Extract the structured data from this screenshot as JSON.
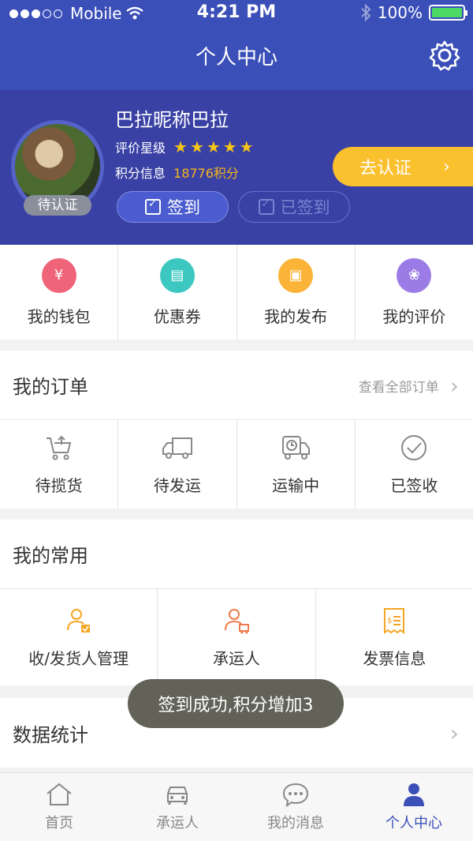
{
  "status_bar": {
    "carrier": "Mobile",
    "time": "4:21 PM",
    "battery": "100%"
  },
  "header": {
    "title": "个人中心"
  },
  "profile": {
    "nickname": "巴拉昵称巴拉",
    "rating_label": "评价星级",
    "rating_stars": 5,
    "points_label": "积分信息",
    "points_value": "18776积分",
    "avatar_badge": "待认证",
    "sign_in_label": "签到",
    "signed_label": "已签到",
    "certify_label": "去认证"
  },
  "quick_menu": [
    {
      "label": "我的钱包",
      "icon": "wallet-icon",
      "color": "#f0647a"
    },
    {
      "label": "优惠券",
      "icon": "coupon-icon",
      "color": "#3cc8c0"
    },
    {
      "label": "我的发布",
      "icon": "box-icon",
      "color": "#fbb437"
    },
    {
      "label": "我的评价",
      "icon": "flower-icon",
      "color": "#9b7ce6"
    }
  ],
  "orders": {
    "title": "我的订单",
    "view_all": "查看全部订单",
    "items": [
      {
        "label": "待揽货",
        "icon": "cart-icon"
      },
      {
        "label": "待发运",
        "icon": "truck-icon"
      },
      {
        "label": "运输中",
        "icon": "truck-clock-icon"
      },
      {
        "label": "已签收",
        "icon": "check-circle-icon"
      }
    ]
  },
  "common": {
    "title": "我的常用",
    "items": [
      {
        "label": "收/发货人管理",
        "icon": "user-check-icon"
      },
      {
        "label": "承运人",
        "icon": "user-truck-icon"
      },
      {
        "label": "发票信息",
        "icon": "invoice-icon"
      }
    ]
  },
  "stats": {
    "title": "数据统计"
  },
  "toast": "签到成功,积分增加3",
  "tabbar": [
    {
      "label": "首页",
      "icon": "home-icon"
    },
    {
      "label": "承运人",
      "icon": "car-icon"
    },
    {
      "label": "我的消息",
      "icon": "chat-icon"
    },
    {
      "label": "个人中心",
      "icon": "person-icon",
      "active": true
    }
  ],
  "colors": {
    "primary": "#3b4fb8",
    "profile_bg": "#3a41a5",
    "accent_yellow": "#fbc02d",
    "points": "#f5b51b",
    "icon_orange": "#f5a623"
  }
}
